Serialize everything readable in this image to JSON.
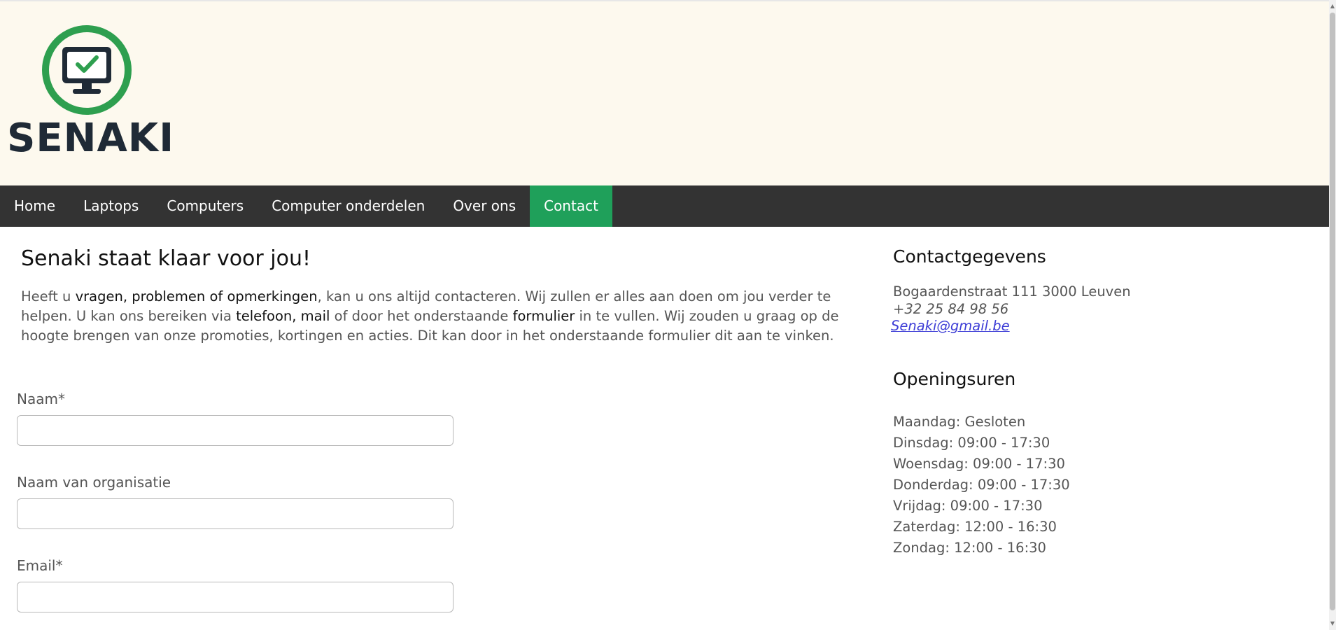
{
  "brand": {
    "name": "SENAKI",
    "logo_icon": "monitor-check-icon",
    "accent": "#2e9f4f",
    "dark": "#1f2a36"
  },
  "nav": {
    "items": [
      {
        "label": "Home",
        "active": false
      },
      {
        "label": "Laptops",
        "active": false
      },
      {
        "label": "Computers",
        "active": false
      },
      {
        "label": "Computer onderdelen",
        "active": false
      },
      {
        "label": "Over ons",
        "active": false
      },
      {
        "label": "Contact",
        "active": true
      }
    ],
    "background": "#333333",
    "active_color": "#1fa05a"
  },
  "main": {
    "title": "Senaki staat klaar voor jou!",
    "intro": {
      "p1": "Heeft u ",
      "b1": "vragen, problemen of opmerkingen",
      "p2": ", kan u ons altijd contacteren. Wij zullen er alles aan doen om jou verder te helpen. U kan ons bereiken via ",
      "b2": "telefoon, mail",
      "p3": " of door het onderstaande ",
      "b3": "formulier",
      "p4": " in te vullen. Wij zouden u graag op de hoogte brengen van onze promoties, kortingen en acties. Dit kan door in het onderstaande formulier dit aan te vinken."
    },
    "form": {
      "name_label": "Naam*",
      "org_label": "Naam van organisatie",
      "email_label": "Email*",
      "name_value": "",
      "org_value": "",
      "email_value": ""
    }
  },
  "sidebar": {
    "contact_heading": "Contactgegevens",
    "address": "Bogaardenstraat 111 3000 Leuven",
    "phone": "+32 25 84 98 56",
    "email": "Senaki@gmail.be",
    "hours_heading": "Openingsuren",
    "hours": [
      "Maandag: Gesloten",
      "Dinsdag: 09:00 - 17:30",
      "Woensdag: 09:00 - 17:30",
      "Donderdag: 09:00 - 17:30",
      "Vrijdag: 09:00 - 17:30",
      "Zaterdag: 12:00 - 16:30",
      "Zondag: 12:00 - 16:30"
    ]
  }
}
